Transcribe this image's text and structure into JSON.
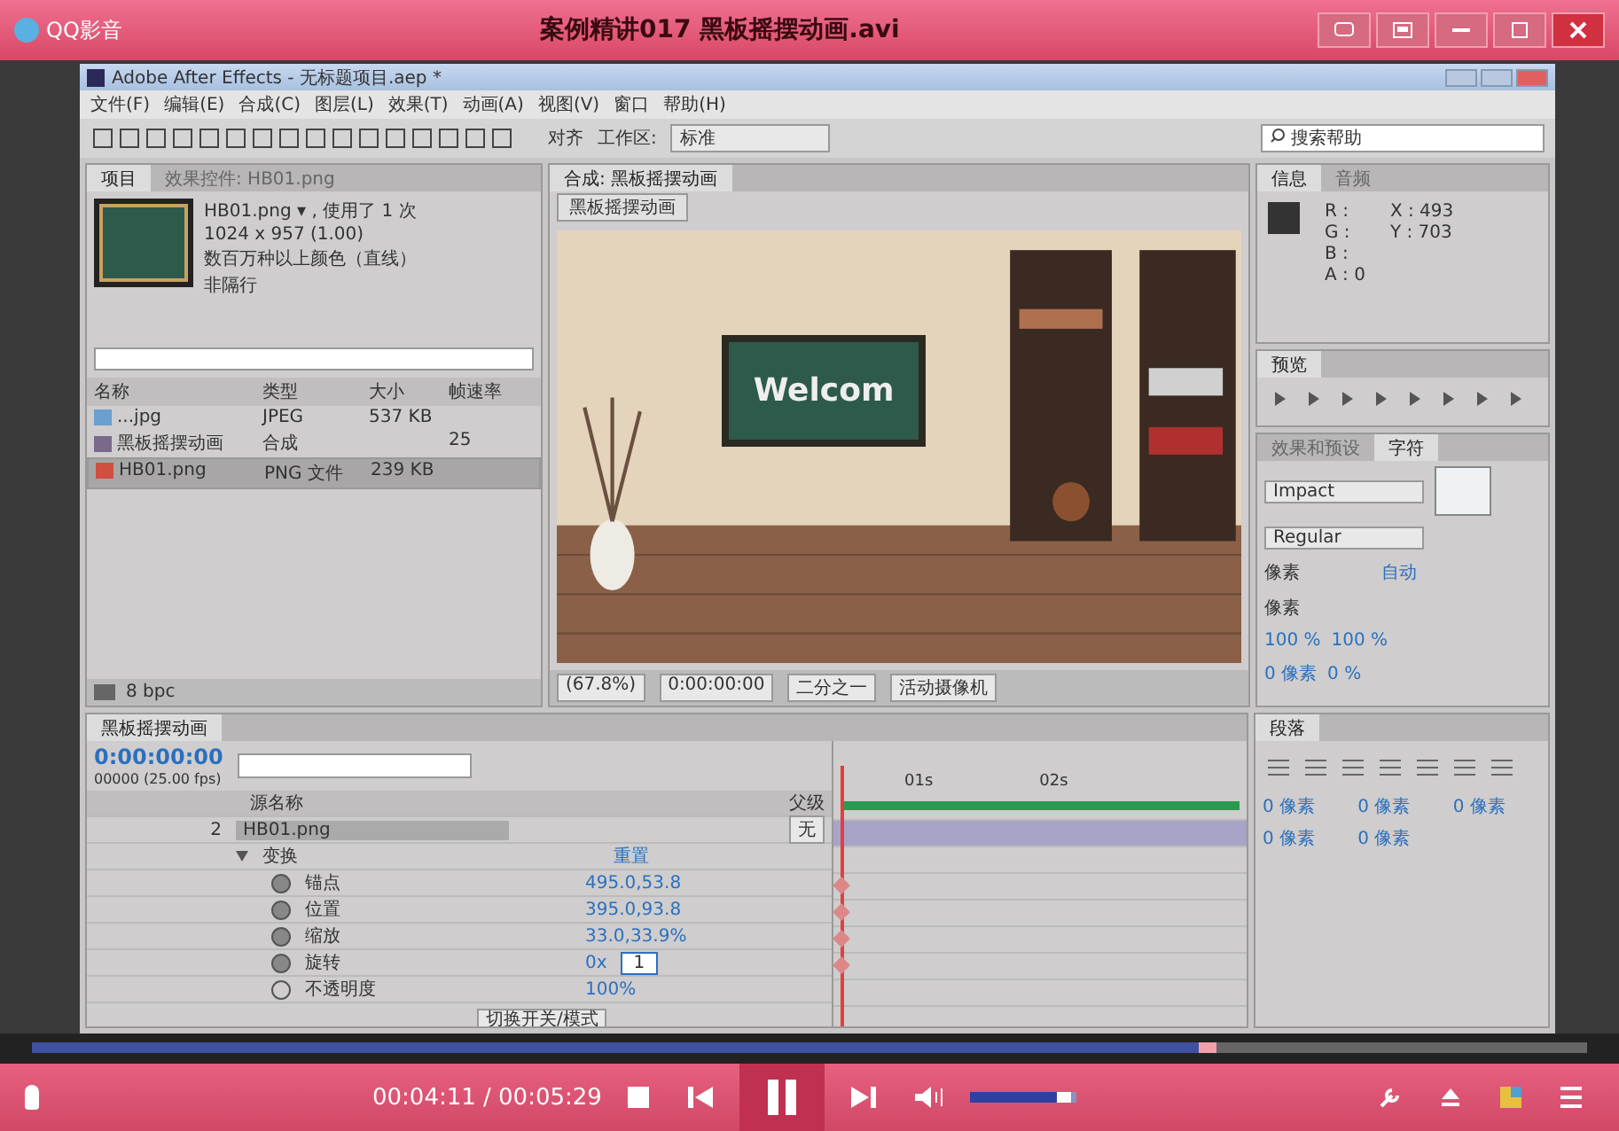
{
  "player": {
    "logo": "QQ影音",
    "title": "案例精讲017 黑板摇摆动画.avi"
  },
  "app": {
    "title": "Adobe After Effects - 无标题项目.aep *",
    "menu": [
      "文件(F)",
      "编辑(E)",
      "合成(C)",
      "图层(L)",
      "效果(T)",
      "动画(A)",
      "视图(V)",
      "窗口",
      "帮助(H)"
    ],
    "toolbar": {
      "snap": "对齐",
      "workspace_label": "工作区:",
      "workspace": "标准",
      "search": "搜索帮助"
    }
  },
  "project": {
    "tabs": [
      {
        "label": "项目",
        "selected": true
      },
      {
        "label": "效果控件: HB01.png",
        "selected": false
      }
    ],
    "info": [
      "HB01.png ▾ , 使用了 1 次",
      "1024 x 957 (1.00)",
      "数百万种以上颜色（直线）",
      "非隔行"
    ],
    "columns": [
      "名称",
      "类型",
      "大小",
      "帧速率"
    ],
    "rows": [
      {
        "name": "...jpg",
        "type": "JPEG",
        "size": "537 KB",
        "rate": "",
        "selected": false
      },
      {
        "name": "黑板摇摆动画",
        "type": "合成",
        "size": "",
        "rate": "25",
        "kind": "comp",
        "selected": false
      },
      {
        "name": "HB01.png",
        "type": "PNG 文件",
        "size": "239 KB",
        "rate": "",
        "kind": "png",
        "selected": true
      }
    ],
    "bpc": "8 bpc"
  },
  "comp": {
    "tab": "合成: 黑板摇摆动画",
    "subtab": "黑板摇摆动画",
    "board_text": "Welcom",
    "zoom": "(67.8%)",
    "time": "0:00:00:00",
    "resolution": "二分之一",
    "camera": "活动摄像机"
  },
  "info": {
    "tabs": [
      {
        "label": "信息",
        "selected": true
      },
      {
        "label": "音频",
        "selected": false
      }
    ],
    "channels": [
      "R :",
      "G :",
      "B :",
      "A : 0"
    ],
    "x": "X : 493",
    "y": "Y : 703"
  },
  "preview": {
    "tab": "预览"
  },
  "character": {
    "tabs": [
      {
        "label": "效果和预设",
        "selected": false
      },
      {
        "label": "字符",
        "selected": true
      }
    ],
    "font": "Impact",
    "style": "Regular",
    "auto": "自动",
    "size_unit": "像素",
    "stroke_unit": "像素",
    "scale_v": "100 %",
    "scale_h": "100 %",
    "baseline": "0 像素",
    "tsume": "0 %"
  },
  "paragraph": {
    "tab": "段落",
    "indents": [
      "0 像素",
      "0 像素",
      "0 像素",
      "0 像素",
      "0 像素"
    ]
  },
  "timeline": {
    "tab": "黑板摇摆动画",
    "time": "0:00:00:00",
    "frames": "00000 (25.00 fps)",
    "source_col": "源名称",
    "parent_col": "父级",
    "layer": {
      "number": "2",
      "name": "HB01.png",
      "parent": "无"
    },
    "group": {
      "name": "变换",
      "reset": "重置"
    },
    "properties": [
      {
        "name": "锚点",
        "value": "495.0,53.8",
        "keyframed": true
      },
      {
        "name": "位置",
        "value": "395.0,93.8",
        "keyframed": true
      },
      {
        "name": "缩放",
        "value": "33.0,33.9%",
        "keyframed": true
      },
      {
        "name": "旋转",
        "value": "0x",
        "entry": "1",
        "keyframed": true
      },
      {
        "name": "不透明度",
        "value": "100%",
        "keyframed": false
      }
    ],
    "ruler": [
      "01s",
      "02s"
    ],
    "toggle": "切换开关/模式"
  },
  "playback": {
    "position": "00:04:11 / 00:05:29",
    "progress": {
      "level": 0.75
    },
    "volume": {
      "level": 0.95
    }
  }
}
